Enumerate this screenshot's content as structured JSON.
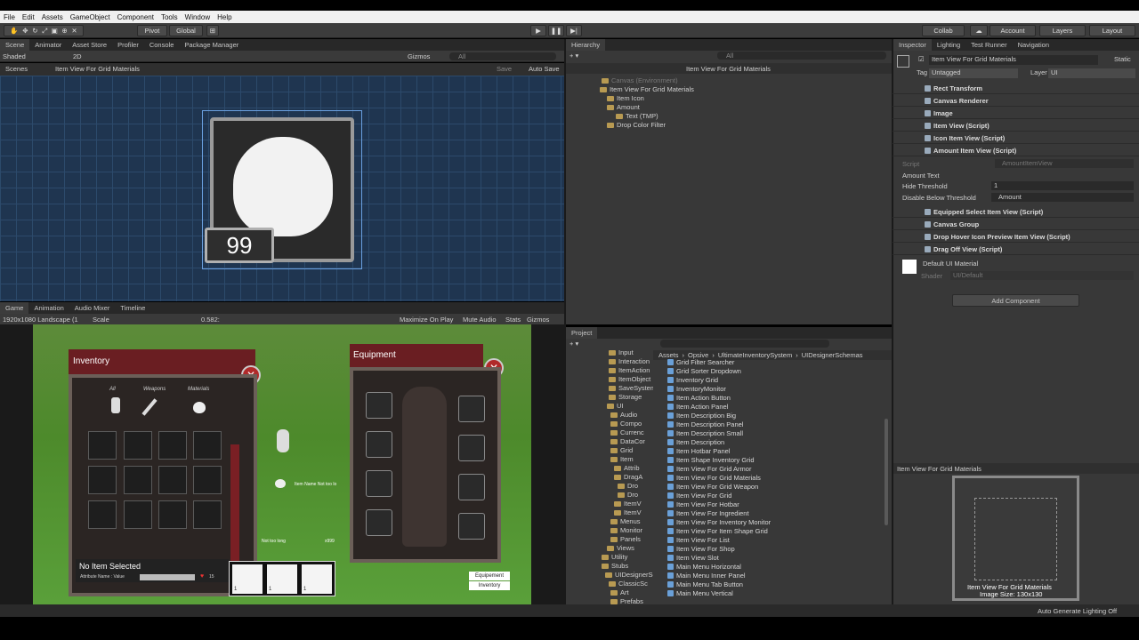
{
  "menu": [
    "File",
    "Edit",
    "Assets",
    "GameObject",
    "Component",
    "Tools",
    "Window",
    "Help"
  ],
  "toolbar": {
    "pivot": "Pivot",
    "global": "Global",
    "collab": "Collab",
    "account": "Account",
    "layers": "Layers",
    "layout": "Layout"
  },
  "scene": {
    "tabs": [
      "Scene",
      "Animator",
      "Asset Store",
      "Profiler",
      "Console",
      "Package Manager"
    ],
    "shading": "Shaded",
    "mode2d": "2D",
    "gizmos": "Gizmos",
    "search": "All",
    "breadcrumb_scenes": "Scenes",
    "breadcrumb_item": "Item View For Grid Materials",
    "save": "Save",
    "autosave": "Auto Save",
    "amount": "99"
  },
  "game": {
    "tabs": [
      "Game",
      "Animation",
      "Audio Mixer",
      "Timeline"
    ],
    "resolution": "1920x1080 Landscape (1",
    "scale_label": "Scale",
    "scale": "0.582:",
    "maximize": "Maximize On Play",
    "mute": "Mute Audio",
    "stats": "Stats",
    "gizmos": "Gizmos",
    "inventory_title": "Inventory",
    "filters": [
      "All",
      "Weapons",
      "Materials"
    ],
    "equipment_title": "Equipment",
    "no_item": "No Item Selected",
    "attribute": "Attribute Name : Value",
    "hp": "15",
    "item_name": "Item Name Not too lo",
    "not_too_long": "Not too long",
    "x999": "x999",
    "btn_equipment": "Equipement",
    "btn_inventory": "Inventory",
    "hotbar": [
      "1",
      "1",
      "1"
    ]
  },
  "hierarchy": {
    "title": "Hierarchy",
    "search": "All",
    "scene": "Item View For Grid Materials",
    "items": [
      "Canvas (Environment)",
      "Item View For Grid Materials",
      "Item Icon",
      "Amount",
      "Text (TMP)",
      "Drop Color Filter"
    ]
  },
  "inspector": {
    "tabs": [
      "Inspector",
      "Lighting",
      "Test Runner",
      "Navigation"
    ],
    "name": "Item View For Grid Materials",
    "static": "Static",
    "tag_label": "Tag",
    "tag": "Untagged",
    "layer_label": "Layer",
    "layer": "UI",
    "components": [
      "Rect Transform",
      "Canvas Renderer",
      "Image",
      "Item View (Script)",
      "Icon Item View (Script)",
      "Amount Item View (Script)"
    ],
    "script_label": "Script",
    "script_value": "AmountItemView",
    "amount_text": "Amount Text",
    "hide_threshold_label": "Hide Threshold",
    "hide_threshold": "1",
    "disable_below_label": "Disable Below Threshold",
    "disable_below": "Amount",
    "components2": [
      "Equipped Select Item View (Script)",
      "Canvas Group",
      "Drop Hover Icon Preview Item View (Script)",
      "Drag Off View (Script)"
    ],
    "material": "Default UI Material",
    "shader_label": "Shader",
    "shader": "UI/Default",
    "add_component": "Add Component",
    "preview_title": "Item View For Grid Materials",
    "preview_name": "Item View For Grid Materials",
    "preview_size": "Image Size: 130x130"
  },
  "project": {
    "title": "Project",
    "breadcrumb": [
      "Assets",
      "Opsive",
      "UltimateInventorySystem",
      "UIDesignerSchemas"
    ],
    "tree": [
      "Input",
      "Interaction",
      "ItemAction",
      "ItemObject",
      "SaveSystem",
      "Storage",
      "UI",
      "Audio",
      "Compo",
      "Currenc",
      "DataCor",
      "Grid",
      "Item",
      "Attrib",
      "DragA",
      "Dro",
      "Dro",
      "ItemV",
      "ItemV",
      "Menus",
      "Monitor",
      "Panels",
      "Views",
      "Utility",
      "Stubs",
      "UIDesignerSc",
      "ClassicSc",
      "Art",
      "Prefabs"
    ],
    "items": [
      "Grid Filter Searcher",
      "Grid Sorter Dropdown",
      "Inventory Grid",
      "InventoryMonitor",
      "Item Action Button",
      "Item Action Panel",
      "Item Description Big",
      "Item Description Panel",
      "Item Description Small",
      "Item Description",
      "Item Hotbar Panel",
      "Item Shape Inventory Grid",
      "Item View For Grid Armor",
      "Item View For Grid Materials",
      "Item View For Grid Weapon",
      "Item View For Grid",
      "Item View For Hotbar",
      "Item View For Ingredient",
      "Item View For Inventory Monitor",
      "Item View For Item Shape Grid",
      "Item View For List",
      "Item View For Shop",
      "Item View Slot",
      "Main Menu Horizontal",
      "Main Menu Inner Panel",
      "Main Menu Tab Button",
      "Main Menu Vertical"
    ]
  },
  "status": {
    "text": "Auto Generate Lighting Off"
  }
}
